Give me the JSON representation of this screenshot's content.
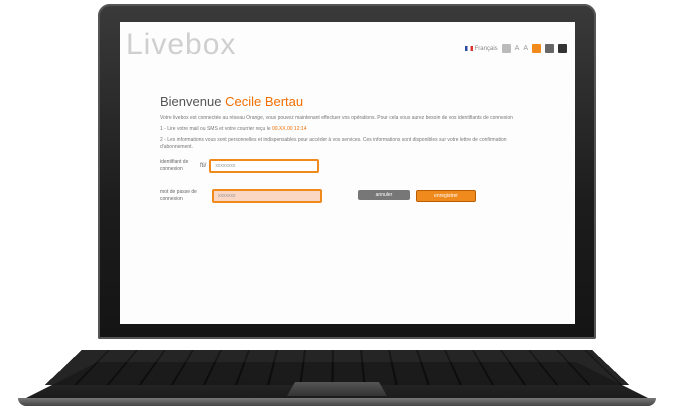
{
  "brand": "Livebox",
  "topbar": {
    "language": "Français"
  },
  "welcome": {
    "prefix": "Bienvenue",
    "name": "Cecile Bertau"
  },
  "intro": "Votre livebox est connectée au réseau Orange, vous pouvez maintenant effectuer vos opérations. Pour cela vous aurez besoin de vos identifiants de connexion",
  "step1": {
    "text": "1 - Lire votre mail ou SMS et votre courrier reçu le",
    "date": "00.XX.00 12:14"
  },
  "step2": "2 - Les informations vous sont personnelles et indispensables pour accéder à vos services. Ces informations sont disponibles sur votre lettre de confirmation d'abonnement.",
  "form": {
    "id_label": "identifiant de connexion",
    "at_symbol": "fti/",
    "id_value": "xxxxxxxx",
    "password_label": "mot de passe de connexion",
    "password_value": "xxxxxxx"
  },
  "buttons": {
    "cancel": "annuler",
    "submit": "enregistrer"
  },
  "colors": {
    "accent": "#f16e00",
    "field_border": "#f08a1c",
    "field_bg_highlight": "#f9d7c4"
  }
}
